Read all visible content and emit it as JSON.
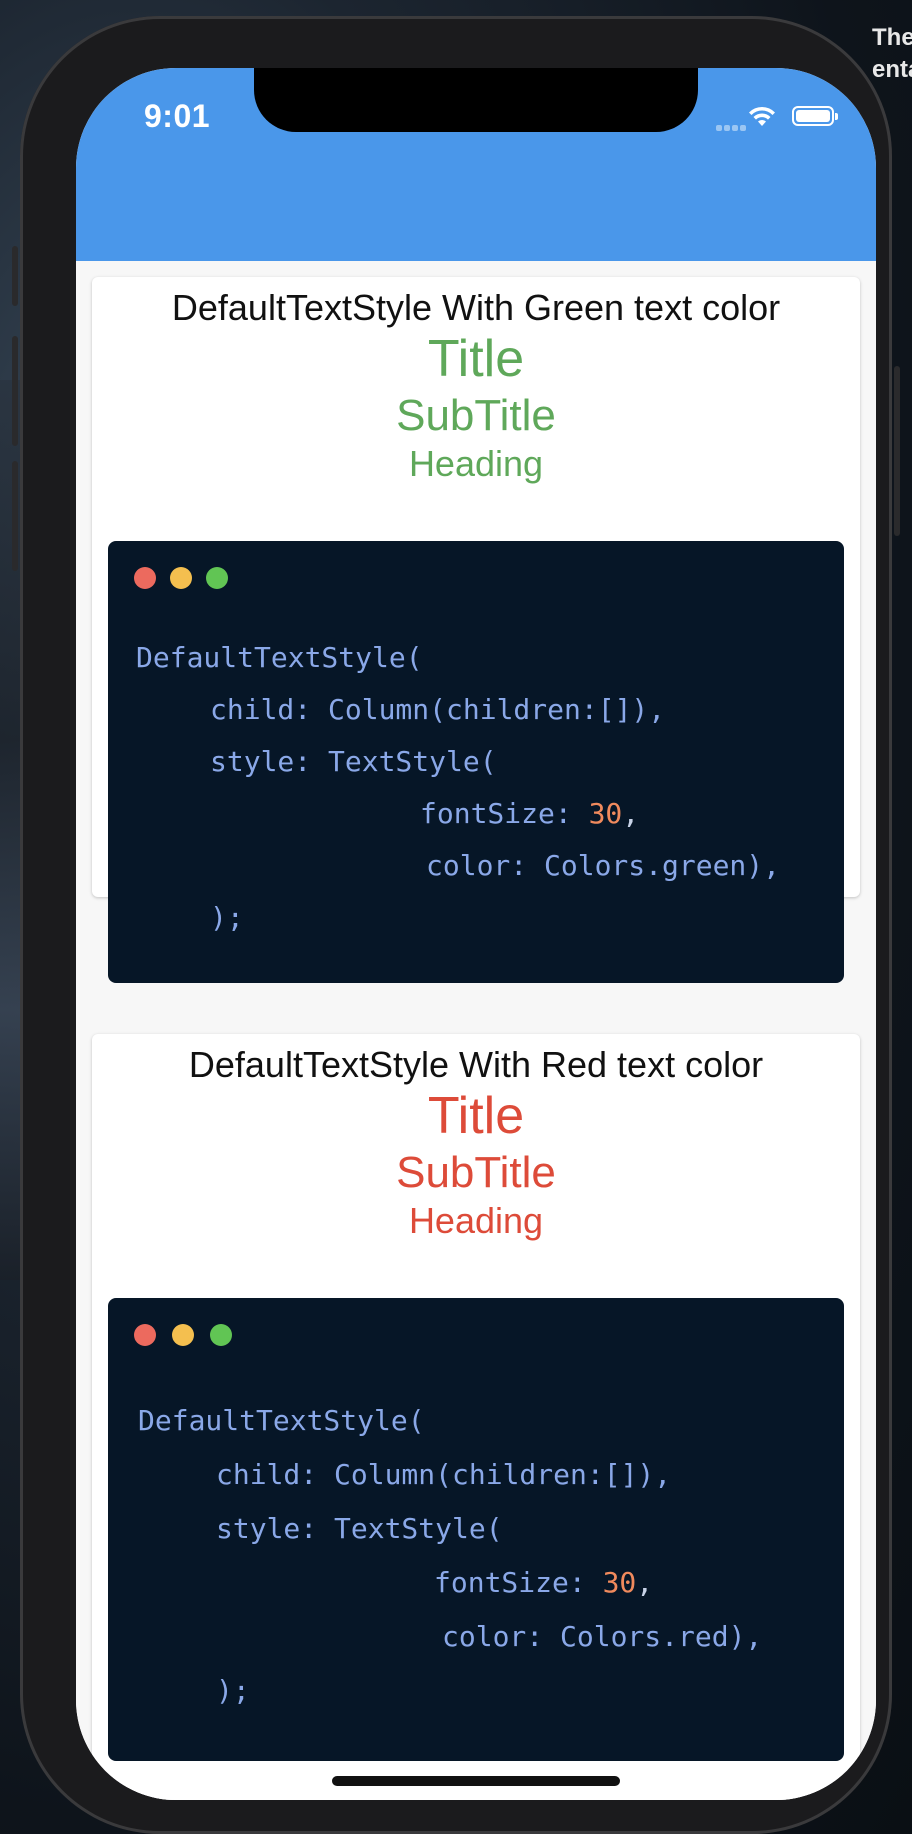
{
  "status_bar": {
    "time": "9:01",
    "battery_level": 1.0
  },
  "background_text": [
    "The",
    "enta"
  ],
  "colors": {
    "app_bar": "#4a97ea",
    "green": "#5fa85a",
    "red": "#dd4b39",
    "code_bg": "#061627"
  },
  "cards": [
    {
      "heading": "DefaultTextStyle With Green text color",
      "title": "Title",
      "subtitle": "SubTitle",
      "label": "Heading",
      "color": "#5fa85a",
      "code": {
        "line1": "DefaultTextStyle(",
        "line2": "child: Column(children:[]),",
        "line3": "style: TextStyle(",
        "line4_key": "fontSize: ",
        "line4_num": "30",
        "line4_end": ",",
        "line5": "color: Colors.green),",
        "line6": ");"
      }
    },
    {
      "heading": "DefaultTextStyle With Red text color",
      "title": "Title",
      "subtitle": "SubTitle",
      "label": "Heading",
      "color": "#dd4b39",
      "code": {
        "line1": "DefaultTextStyle(",
        "line2": "child: Column(children:[]),",
        "line3": "style: TextStyle(",
        "line4_key": "fontSize: ",
        "line4_num": "30",
        "line4_end": ",",
        "line5": "color: Colors.red),",
        "line6": ");"
      }
    }
  ]
}
